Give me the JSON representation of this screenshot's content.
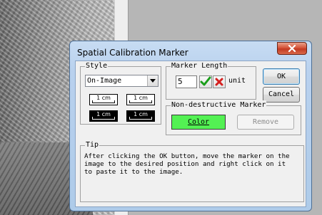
{
  "window": {
    "title": "Spatial Calibration Marker"
  },
  "style_group": {
    "legend": "Style",
    "select_value": "On-Image",
    "samples": [
      "1 cm",
      "1 cm",
      "1 cm",
      "1 cm"
    ]
  },
  "marker_length": {
    "legend": "Marker Length",
    "value": "5",
    "unit": "unit"
  },
  "buttons": {
    "ok": "OK",
    "cancel": "Cancel"
  },
  "nondestructive": {
    "legend": "Non-destructive Marker",
    "color_label": "Color",
    "remove_label": "Remove",
    "marker_color": "#53f153"
  },
  "tip": {
    "legend": "Tip",
    "text": "After clicking the OK button, move the marker on the\nimage to the desired position and right click on it\nto paste it to the image."
  },
  "icons": {
    "confirm": "check-icon",
    "cancel": "x-icon",
    "close": "close-icon"
  }
}
